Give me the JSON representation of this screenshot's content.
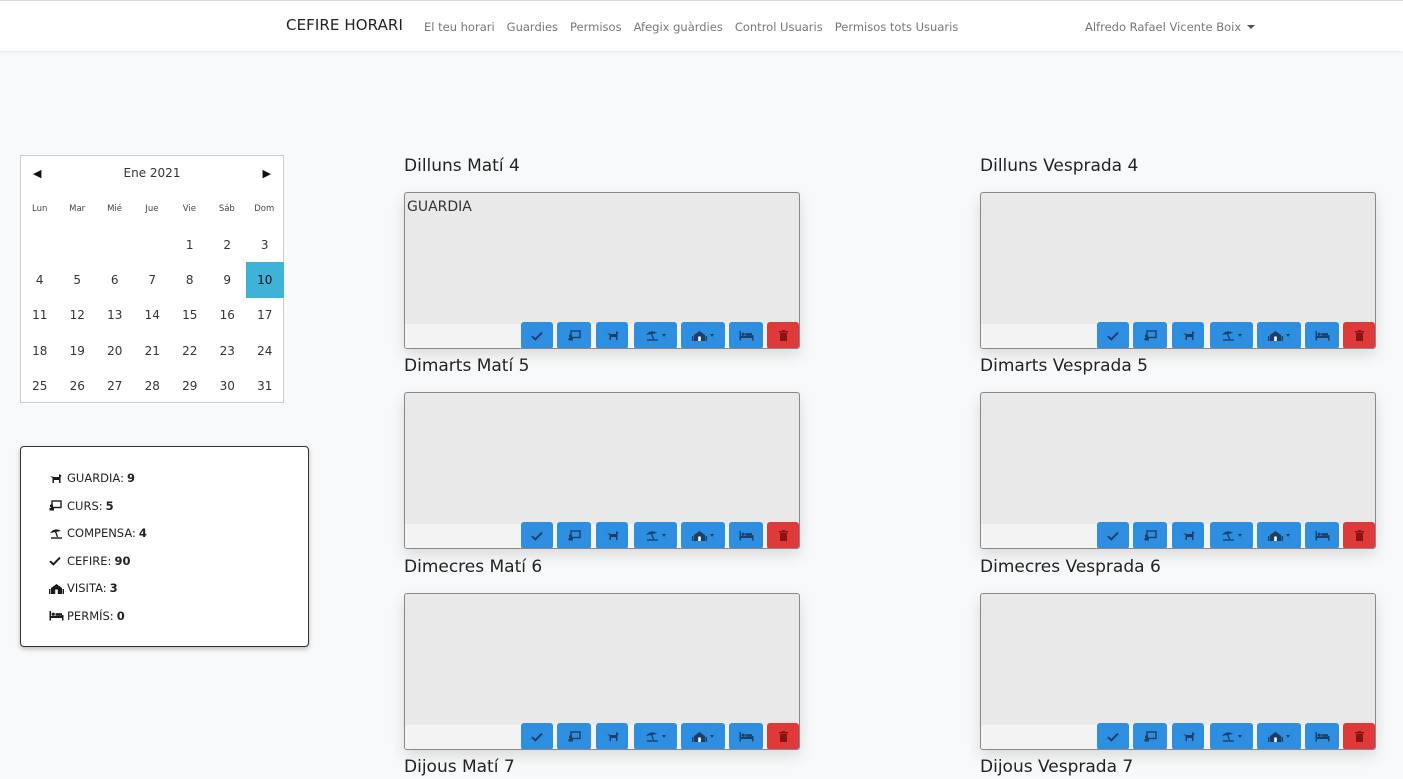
{
  "navbar": {
    "brand": "CEFIRE HORARI",
    "links": [
      "El teu horari",
      "Guardies",
      "Permisos",
      "Afegix guàrdies",
      "Control Usuaris",
      "Permisos tots Usuaris"
    ],
    "user": "Alfredo Rafael Vicente Boix"
  },
  "calendar": {
    "month_label": "Ene 2021",
    "prev_symbol": "◀",
    "next_symbol": "▶",
    "weekdays": [
      "Lun",
      "Mar",
      "Mié",
      "Jue",
      "Vie",
      "Sáb",
      "Dom"
    ],
    "days": [
      "",
      "",
      "",
      "",
      "1",
      "2",
      "3",
      "4",
      "5",
      "6",
      "7",
      "8",
      "9",
      "10",
      "11",
      "12",
      "13",
      "14",
      "15",
      "16",
      "17",
      "18",
      "19",
      "20",
      "21",
      "22",
      "23",
      "24",
      "25",
      "26",
      "27",
      "28",
      "29",
      "30",
      "31"
    ],
    "selected_day": "10",
    "selected_color": "#3fb3d7"
  },
  "summary": [
    {
      "icon": "dog-icon",
      "label": "GUARDIA:",
      "value": "9"
    },
    {
      "icon": "chalkboard-icon",
      "label": "CURS:",
      "value": "5"
    },
    {
      "icon": "umbrella-beach-icon",
      "label": "COMPENSA:",
      "value": "4"
    },
    {
      "icon": "check-icon",
      "label": "CEFIRE:",
      "value": "90"
    },
    {
      "icon": "school-icon",
      "label": "VISITA:",
      "value": "3"
    },
    {
      "icon": "bed-icon",
      "label": "PERMÍS:",
      "value": "0"
    }
  ],
  "days": [
    {
      "label": "Dilluns Matí 4",
      "content": "GUARDIA"
    },
    {
      "label": "Dilluns Vesprada 4",
      "content": ""
    },
    {
      "label": "Dimarts Matí 5",
      "content": ""
    },
    {
      "label": "Dimarts Vesprada 5",
      "content": ""
    },
    {
      "label": "Dimecres Matí 6",
      "content": ""
    },
    {
      "label": "Dimecres Vesprada 6",
      "content": ""
    },
    {
      "label": "Dijous Matí 7",
      "content": ""
    },
    {
      "label": "Dijous Vesprada 7",
      "content": ""
    }
  ],
  "card_buttons": [
    {
      "icon": "check-icon",
      "dropdown": false,
      "color": "#2e8fe0"
    },
    {
      "icon": "chalkboard-icon",
      "dropdown": false,
      "color": "#2e8fe0"
    },
    {
      "icon": "dog-icon",
      "dropdown": false,
      "color": "#2e8fe0"
    },
    {
      "icon": "umbrella-beach-icon",
      "dropdown": true,
      "color": "#2e8fe0"
    },
    {
      "icon": "school-icon",
      "dropdown": true,
      "color": "#2e8fe0"
    },
    {
      "icon": "bed-icon",
      "dropdown": false,
      "color": "#2e8fe0"
    },
    {
      "icon": "trash-icon",
      "dropdown": false,
      "color": "#df3a3a"
    }
  ]
}
